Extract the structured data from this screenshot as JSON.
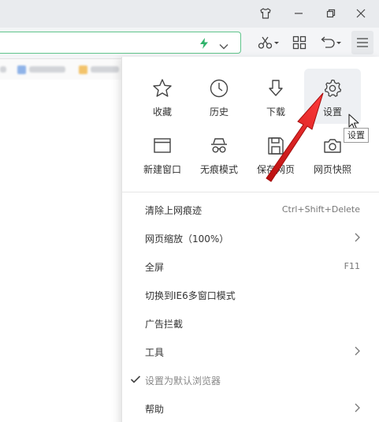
{
  "window_controls": {
    "skin_icon": "tshirt-icon",
    "minimize_icon": "minimize-icon",
    "restore_icon": "restore-icon",
    "close_icon": "close-icon"
  },
  "toolbar": {
    "address_value": "",
    "accel_icon": "lightning-icon",
    "dropdown_icon": "chevron-down-icon",
    "cut_icon": "scissors-icon",
    "apps_icon": "grid-icon",
    "undo_icon": "undo-icon",
    "menu_icon": "hamburger-icon"
  },
  "colors": {
    "accent_green": "#5fc48b",
    "arrow_red": "#e02020",
    "hover_bg": "#eef0f3"
  },
  "menu": {
    "grid": [
      {
        "label": "收藏",
        "icon": "star-icon"
      },
      {
        "label": "历史",
        "icon": "clock-icon"
      },
      {
        "label": "下载",
        "icon": "download-icon"
      },
      {
        "label": "设置",
        "icon": "gear-icon"
      },
      {
        "label": "新建窗口",
        "icon": "new-window-icon"
      },
      {
        "label": "无痕模式",
        "icon": "incognito-icon"
      },
      {
        "label": "保存网页",
        "icon": "save-icon"
      },
      {
        "label": "网页快照",
        "icon": "camera-icon"
      }
    ],
    "items": [
      {
        "label": "清除上网痕迹",
        "shortcut": "Ctrl+Shift+Delete"
      },
      {
        "label": "网页缩放（100%）",
        "submenu": true
      },
      {
        "label": "全屏",
        "shortcut": "F11"
      },
      {
        "label": "切换到IE6多窗口模式"
      },
      {
        "label": "广告拦截"
      },
      {
        "label": "工具",
        "submenu": true
      },
      {
        "label": "设置为默认浏览器",
        "checked": true
      },
      {
        "label": "帮助",
        "submenu": true
      }
    ]
  },
  "tooltip": "设置"
}
